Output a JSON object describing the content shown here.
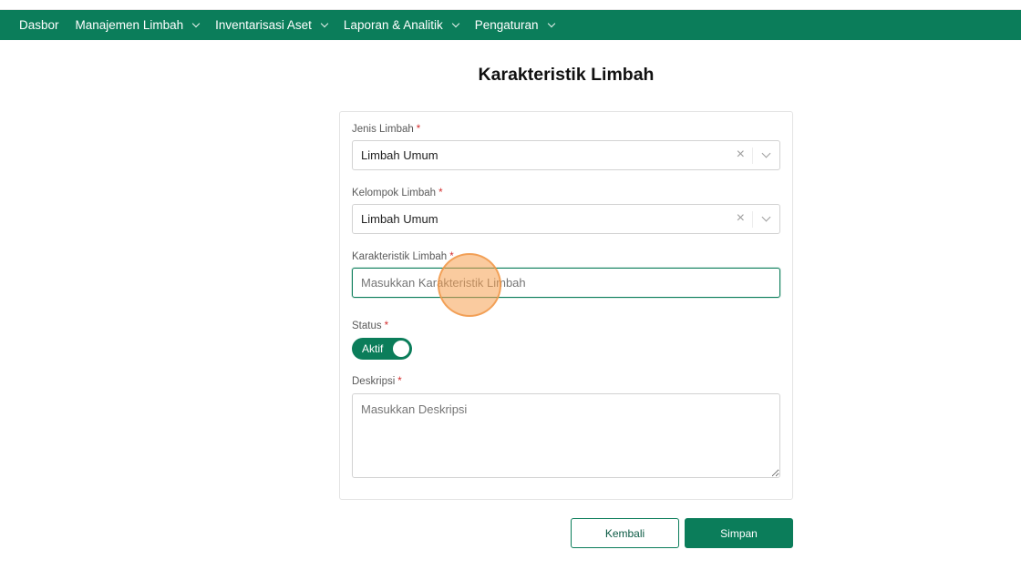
{
  "nav": {
    "items": [
      {
        "label": "Dasbor",
        "has_dropdown": false
      },
      {
        "label": "Manajemen Limbah",
        "has_dropdown": true
      },
      {
        "label": "Inventarisasi Aset",
        "has_dropdown": true
      },
      {
        "label": "Laporan & Analitik",
        "has_dropdown": true
      },
      {
        "label": "Pengaturan",
        "has_dropdown": true
      }
    ]
  },
  "page": {
    "title": "Karakteristik Limbah"
  },
  "form": {
    "required_mark": "*",
    "jenis": {
      "label": "Jenis Limbah",
      "value": "Limbah Umum",
      "clear_icon": "×"
    },
    "kelompok": {
      "label": "Kelompok Limbah",
      "value": "Limbah Umum",
      "clear_icon": "×"
    },
    "karakteristik": {
      "label": "Karakteristik Limbah",
      "value": "",
      "placeholder": "Masukkan Karakteristik Limbah"
    },
    "status": {
      "label": "Status",
      "toggle_label": "Aktif",
      "on": true
    },
    "deskripsi": {
      "label": "Deskripsi",
      "value": "",
      "placeholder": "Masukkan Deskripsi"
    }
  },
  "actions": {
    "back_label": "Kembali",
    "save_label": "Simpan"
  },
  "colors": {
    "primary": "#0b7d5a",
    "required": "#d32f2f",
    "cursor_highlight": "#f5a050"
  }
}
